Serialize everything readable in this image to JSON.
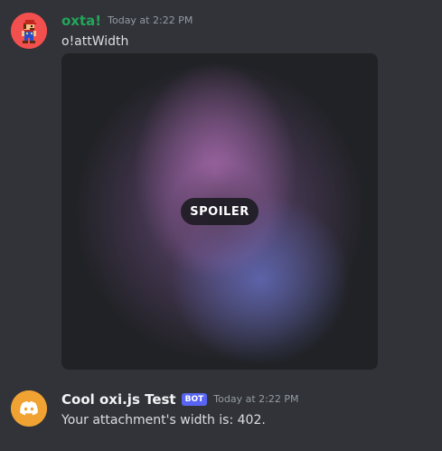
{
  "messages": [
    {
      "avatar_icon": "mario-pixel-avatar-icon",
      "username": "oxta!",
      "username_color": "#23a55a",
      "timestamp": "Today at 2:22 PM",
      "content": "o!attWidth",
      "attachment": {
        "type": "spoiler-image",
        "overlay_label": "SPOILER"
      }
    },
    {
      "avatar_icon": "discord-logo-icon",
      "username": "Cool oxi.js Test",
      "username_color": "#f2f3f5",
      "badge": "BOT",
      "badge_color": "#5865f2",
      "timestamp": "Today at 2:22 PM",
      "content": "Your attachment's width is: 402."
    }
  ],
  "colors": {
    "background": "#313338",
    "text": "#dbdee1",
    "muted": "#949ba4"
  }
}
